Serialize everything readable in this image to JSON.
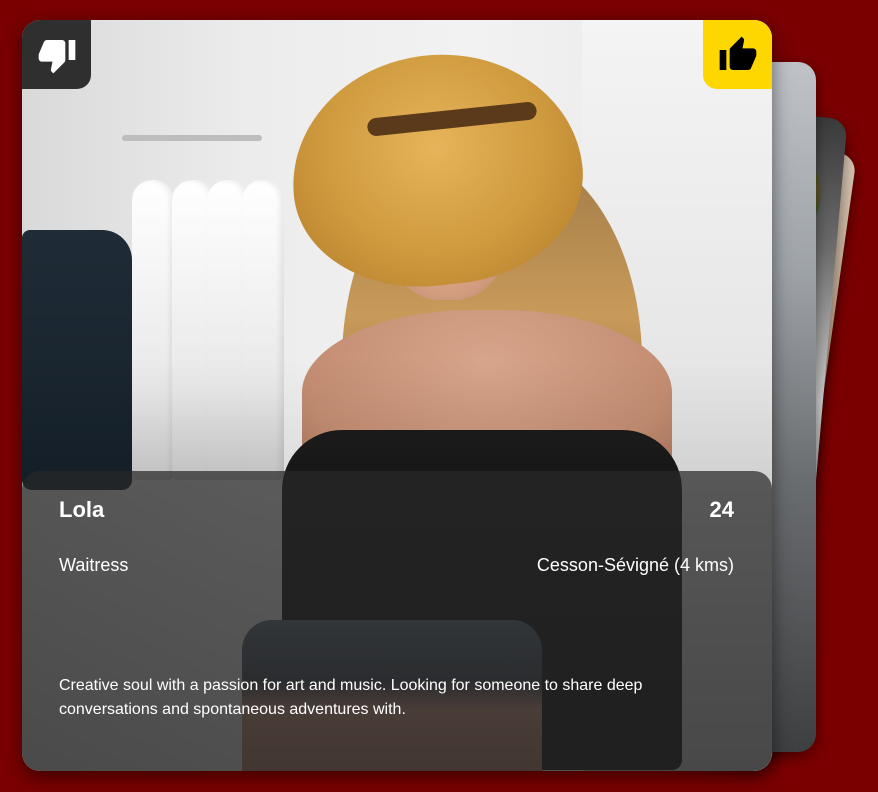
{
  "profile": {
    "name": "Lola",
    "age": "24",
    "job": "Waitress",
    "location": "Cesson-Sévigné (4 kms)",
    "bio": "Creative soul with a passion for art and music. Looking for someone to share deep conversations and spontaneous adventures with."
  },
  "actions": {
    "dislike_icon": "thumbs-down-icon",
    "like_icon": "thumbs-up-icon"
  },
  "colors": {
    "background": "#7a0000",
    "like_button": "#ffd700",
    "dislike_button": "#2f2f2f",
    "info_panel": "rgba(40,40,40,0.72)"
  }
}
